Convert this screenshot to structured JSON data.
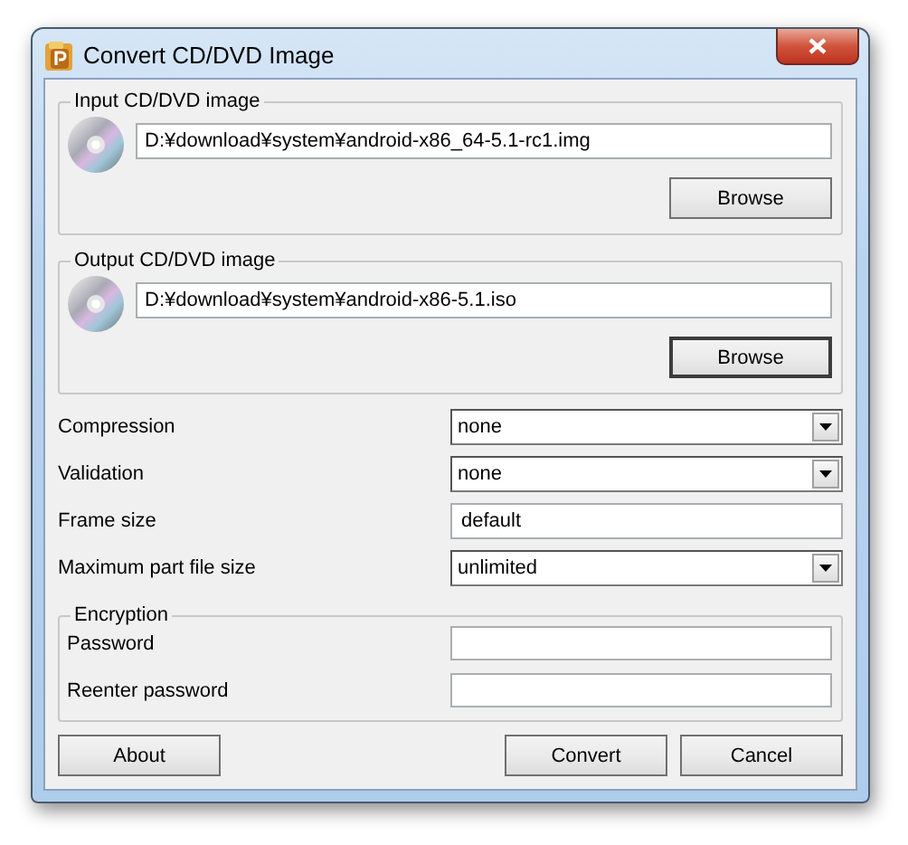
{
  "window": {
    "title": "Convert CD/DVD Image"
  },
  "input_group": {
    "legend": "Input CD/DVD image",
    "path": "D:¥download¥system¥android-x86_64-5.1-rc1.img",
    "button": {
      "label": "Browse",
      "default": false
    }
  },
  "output_group": {
    "legend": "Output CD/DVD image",
    "path": "D:¥download¥system¥android-x86-5.1.iso",
    "button": {
      "label": "Browse",
      "default": true
    }
  },
  "options": [
    {
      "label": "Compression",
      "kind": "dropdown",
      "value": "none"
    },
    {
      "label": "Validation",
      "kind": "dropdown",
      "value": "none"
    },
    {
      "label": "Frame size",
      "kind": "text",
      "value": "default"
    },
    {
      "label": "Maximum part file size",
      "kind": "dropdown",
      "value": "unlimited"
    }
  ],
  "encryption": {
    "legend": "Encryption",
    "fields": [
      {
        "label": "Password"
      },
      {
        "label": "Reenter password"
      }
    ]
  },
  "footer": {
    "left": [
      "About"
    ],
    "right": [
      "Convert",
      "Cancel"
    ]
  }
}
